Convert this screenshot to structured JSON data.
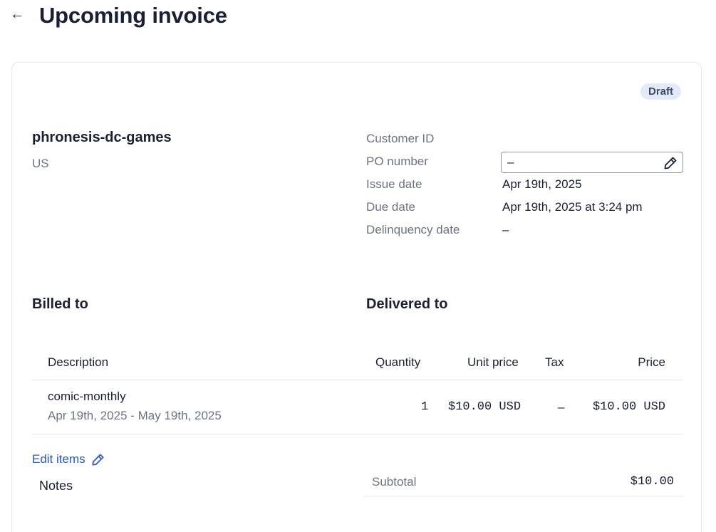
{
  "header": {
    "back_icon": "←",
    "title": "Upcoming invoice"
  },
  "invoice": {
    "status_badge": "Draft",
    "company_name": "phronesis-dc-games",
    "company_country": "US"
  },
  "meta": {
    "customer_id_label": "Customer ID",
    "po_number_label": "PO number",
    "po_number_value": "–",
    "issue_date_label": "Issue date",
    "issue_date_value": "Apr 19th, 2025",
    "due_date_label": "Due date",
    "due_date_value": "Apr 19th, 2025 at 3:24 pm",
    "delinquency_date_label": "Delinquency date",
    "delinquency_date_value": "–"
  },
  "sections": {
    "billed_to": "Billed to",
    "delivered_to": "Delivered to"
  },
  "table": {
    "headers": {
      "description": "Description",
      "quantity": "Quantity",
      "unit_price": "Unit price",
      "tax": "Tax",
      "price": "Price"
    },
    "rows": [
      {
        "description": "comic-monthly",
        "period": "Apr 19th, 2025 - May 19th, 2025",
        "quantity": "1",
        "unit_price": "$10.00 USD",
        "tax": "–",
        "price": "$10.00 USD"
      }
    ]
  },
  "footer": {
    "edit_items_label": "Edit items",
    "notes_label": "Notes",
    "subtotal_label": "Subtotal",
    "subtotal_value": "$10.00"
  },
  "icons": {
    "back": "arrow-left-icon",
    "po_edit": "pencil-icon",
    "edit_items": "pencil-icon"
  },
  "colors": {
    "link": "#2059d3",
    "badge_bg": "#e3ebfa",
    "muted_text": "#6b7385",
    "border": "#e3e8ee"
  }
}
